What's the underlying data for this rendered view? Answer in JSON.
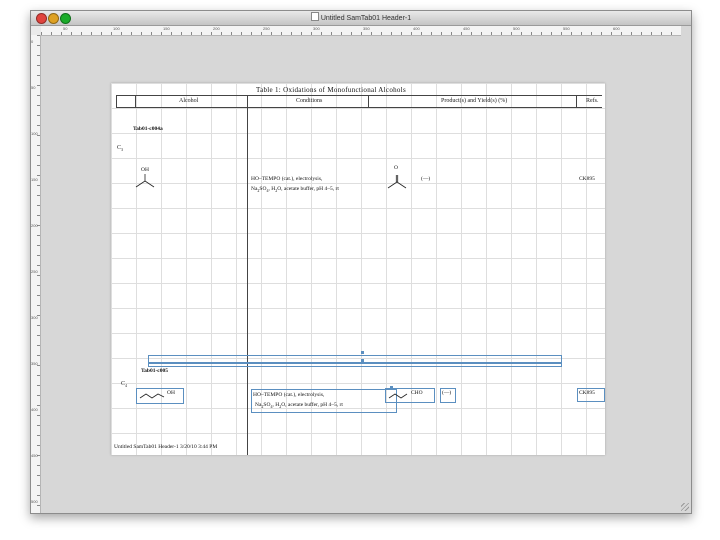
{
  "window": {
    "title": "Untitled SamTab01 Header-1"
  },
  "ruler": {
    "h_labels": [
      "50",
      "100",
      "150",
      "200",
      "250",
      "300",
      "350",
      "400",
      "450",
      "500",
      "550",
      "600"
    ],
    "v_labels": [
      "0",
      "50",
      "100",
      "150",
      "200",
      "250",
      "300",
      "350",
      "400",
      "450",
      "500"
    ]
  },
  "table": {
    "title": "Table 1: Oxidations of Monofunctional Alcohols",
    "headers": {
      "alcohol": "Alcohol",
      "conditions": "Conditions",
      "products": "Product(s) and Yield(s) (%)",
      "refs": "Refs."
    },
    "row1": {
      "tag": "Tab01-c004a",
      "carbon": "C",
      "carbon_sub": "3",
      "oh_label": "OH",
      "conditions_line1": "HO–TEMPO (cat.), electrolysis,",
      "conditions_line2_pre": "Na",
      "conditions_line2_sub1": "2",
      "conditions_line2_mid1": "SO",
      "conditions_line2_sub2": "4",
      "conditions_line2_mid2": ", H",
      "conditions_line2_sub3": "2",
      "conditions_line2_post": "O, acetate buffer, pH 4–5, rt",
      "o_label": "O",
      "yield": "(—)",
      "ref": "CK895"
    },
    "row2": {
      "tag": "Tab01-c005",
      "carbon": "C",
      "carbon_sub": "4",
      "oh_label": "OH",
      "conditions_line1": "HO–TEMPO (cat.), electrolysis,",
      "conditions_line2_pre": "Na",
      "conditions_line2_sub1": "2",
      "conditions_line2_mid1": "SO",
      "conditions_line2_sub2": "4",
      "conditions_line2_mid2": ", H",
      "conditions_line2_sub3": "2",
      "conditions_line2_post": "O, acetate buffer, pH 4–5, rt",
      "product_label": "CHO",
      "yield": "(—)",
      "ref": "CK895"
    },
    "footer": "Untitled SamTab01 Header-1 3/20/10 3:44 PM"
  },
  "colors": {
    "selection": "#5b8fc0",
    "canvas_bg": "#d7d7d7"
  }
}
